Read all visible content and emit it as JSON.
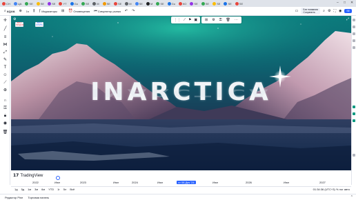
{
  "browser_tabs": [
    {
      "label": "СН",
      "color": "#e8453c"
    },
    {
      "label": "ЦА",
      "color": "#4285f4"
    },
    {
      "label": "SE",
      "color": "#34a853"
    },
    {
      "label": "SE",
      "color": "#fbbc05"
    },
    {
      "label": "SE",
      "color": "#9334e6"
    },
    {
      "label": "YT",
      "color": "#e8453c"
    },
    {
      "label": "Gu",
      "color": "#1a73e8"
    },
    {
      "label": "SE",
      "color": "#34a853"
    },
    {
      "label": "М",
      "color": "#5f6368"
    },
    {
      "label": "SE",
      "color": "#f29900"
    },
    {
      "label": "SE",
      "color": "#e8453c"
    },
    {
      "label": "М",
      "color": "#5f6368"
    },
    {
      "label": "SE",
      "color": "#4285f4"
    },
    {
      "label": "М",
      "color": "#202124"
    },
    {
      "label": "SE",
      "color": "#34a853"
    },
    {
      "label": "Gu",
      "color": "#1a73e8"
    },
    {
      "label": "КО",
      "color": "#e8453c"
    },
    {
      "label": "SE",
      "color": "#9334e6"
    },
    {
      "label": "SE",
      "color": "#34a853"
    },
    {
      "label": "SE",
      "color": "#fbbc05"
    },
    {
      "label": "SE",
      "color": "#1a73e8"
    },
    {
      "label": "SE",
      "color": "#e8453c"
    }
  ],
  "toolbar": {
    "symbol": "AQUA",
    "interval": "1ч",
    "indicators": "Индикаторы",
    "alerts": "Оповещения",
    "replay": "Симулятор рынка",
    "layout_name": "Без названия",
    "layout_sub": "Сохранить",
    "publish": "SE"
  },
  "chart": {
    "title_text": "INARCTICA",
    "tag_left_top": "587,0",
    "tag_left_bottom": "ПРОДАТЬ",
    "tag_right_top": "587,0",
    "tag_right_bottom": "КУПИТЬ"
  },
  "watermark": {
    "text": "TradingView"
  },
  "time_axis": {
    "ticks": [
      "2022",
      "Июл",
      "2023",
      "Июл",
      "2024",
      "Июл",
      "чт 08 Дек '24",
      "Июл",
      "2026",
      "Июл",
      "2027"
    ]
  },
  "range_bar": {
    "items": [
      "1д",
      "5д",
      "1м",
      "3м",
      "6м",
      "YTD",
      "1г",
      "5л",
      "Всё"
    ],
    "right": "01:34:36 (UTC+3)  %  лог  авто"
  },
  "bottom_panel": {
    "pine_editor": "Редактор Pine",
    "trading_panel": "Торговая панель"
  }
}
